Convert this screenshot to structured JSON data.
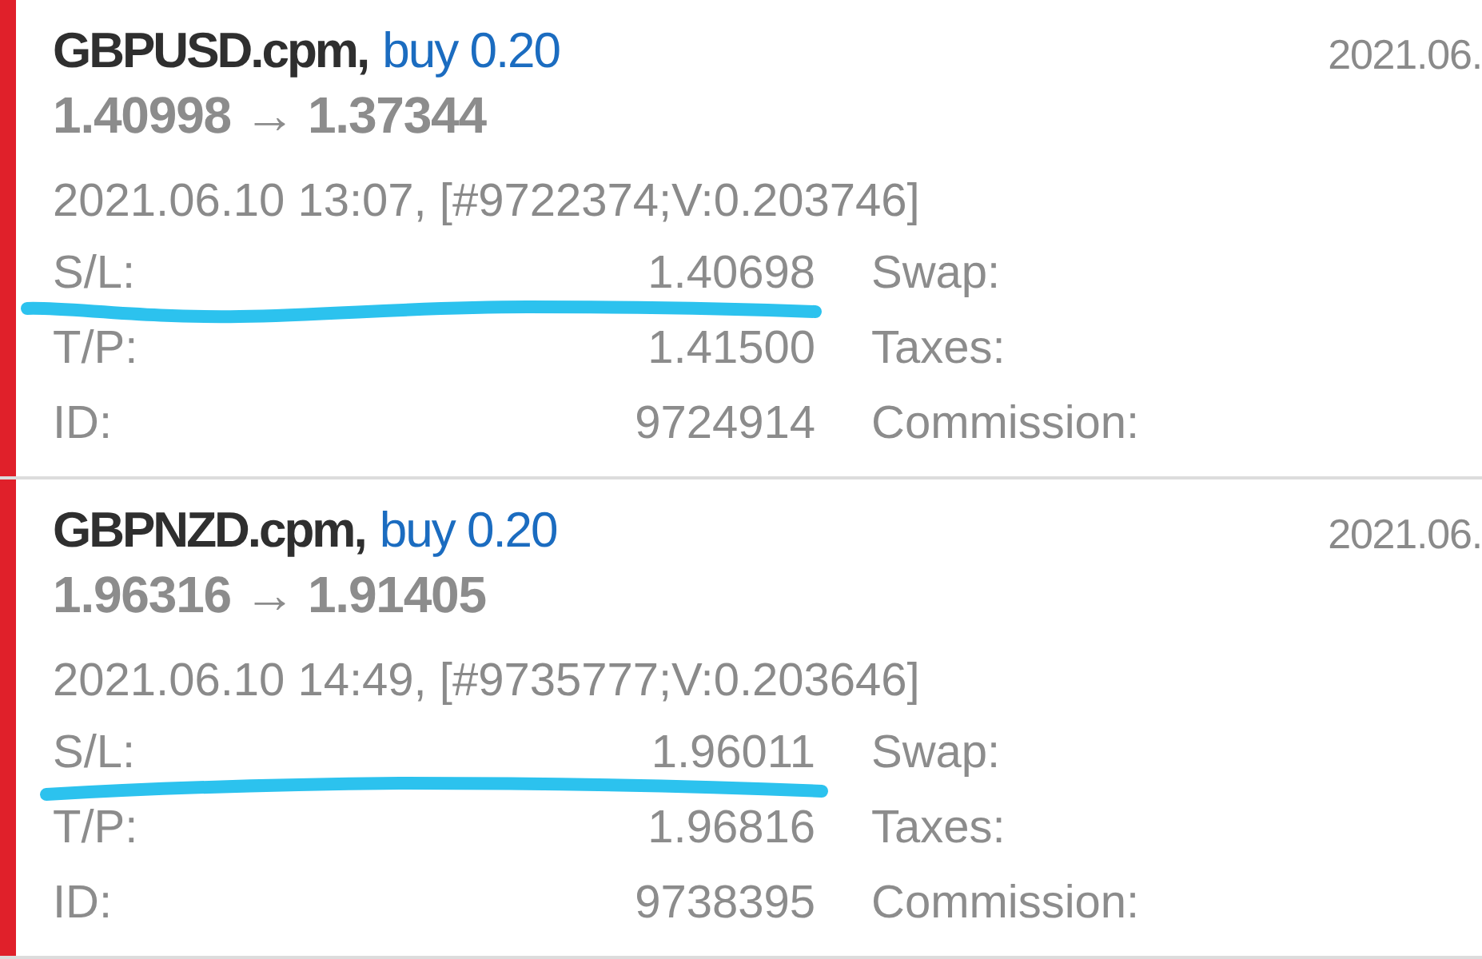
{
  "deals": [
    {
      "color": "#e0202a",
      "symbol": "GBPUSD.cpm,",
      "order": "buy 0.20",
      "prices": "1.40998 → 1.37344",
      "info": "2021.06.10 13:07, [#9722374;V:0.203746]",
      "date": "2021.06.",
      "fields": [
        {
          "label": "S/L:",
          "value": "1.40698",
          "extra": "Swap:"
        },
        {
          "label": "T/P:",
          "value": "1.41500",
          "extra": "Taxes:"
        },
        {
          "label": "ID:",
          "value": "9724914",
          "extra": "Commission:"
        }
      ]
    },
    {
      "color": "#e0202a",
      "symbol": "GBPNZD.cpm,",
      "order": "buy 0.20",
      "prices": "1.96316 → 1.91405",
      "info": "2021.06.10 14:49, [#9735777;V:0.203646]",
      "date": "2021.06.",
      "fields": [
        {
          "label": "S/L:",
          "value": "1.96011",
          "extra": "Swap:"
        },
        {
          "label": "T/P:",
          "value": "1.96816",
          "extra": "Taxes:"
        },
        {
          "label": "ID:",
          "value": "9738395",
          "extra": "Commission:"
        }
      ]
    }
  ]
}
